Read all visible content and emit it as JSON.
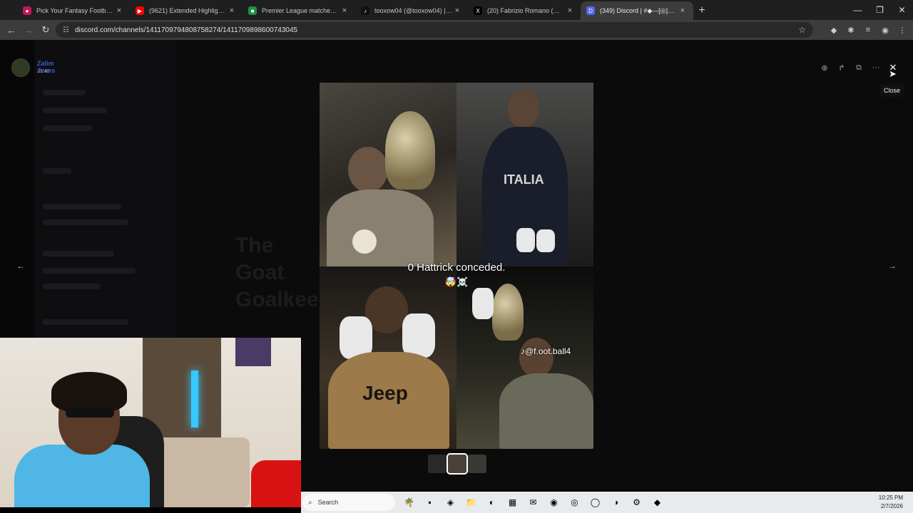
{
  "browser": {
    "tabs": [
      {
        "title": "Pick Your Fantasy Football Team",
        "fav_color": "#c2185b",
        "fav_glyph": "●"
      },
      {
        "title": "(9621) Extended Highlights | M",
        "fav_color": "#ff0000",
        "fav_glyph": "▶"
      },
      {
        "title": "Premier League matches, table",
        "fav_color": "#1e8e3e",
        "fav_glyph": "■"
      },
      {
        "title": "tooxow04 (@tooxow04) | TikTok",
        "fav_color": "#111111",
        "fav_glyph": "♪"
      },
      {
        "title": "(20) Fabrizio Romano (@Fabrizio",
        "fav_color": "#000000",
        "fav_glyph": "X"
      },
      {
        "title": "(349) Discord | #◆—[◎]FOOTB",
        "fav_color": "#5865f2",
        "fav_glyph": "D",
        "active": true
      }
    ],
    "tab_close": "×",
    "new_tab": "+",
    "window_controls": {
      "minimize": "—",
      "maximize": "❐",
      "close": "✕"
    },
    "nav": {
      "back": "←",
      "forward": "→",
      "reload": "↻"
    },
    "url": "discord.com/channels/1411709794808758274/1411709898600743045",
    "star_icon": "☆",
    "extensions": [
      "◆",
      "✱",
      "≡",
      "◉",
      "⋮"
    ]
  },
  "viewer": {
    "user_name": "Zalim Jeans",
    "timestamp": "21:40",
    "tools": {
      "zoom": "⊕",
      "forward": "↱",
      "open": "⧉",
      "more": "···",
      "close": "✕"
    },
    "close_tooltip": "Close",
    "prev_arrow": "←",
    "next_arrow": "→"
  },
  "media": {
    "caption": "0 Hattrick conceded.",
    "emojis": "🤯☠️",
    "shirt_italia": "ITALIA",
    "shirt_jeep": "Jeep",
    "handle": "@f.oot.ball4",
    "tiktok_icon": "♪"
  },
  "background_text": {
    "goat_title": "The\nGoat\nGoalkee"
  },
  "taskbar": {
    "search_placeholder": "Search",
    "search_icon": "⌕",
    "apps": [
      "🌴",
      "▪",
      "◈",
      "📁",
      "◐",
      "▦",
      "✉",
      "◉",
      "◎",
      "◯",
      "◑",
      "⚙",
      "◆"
    ],
    "time": "10:25 PM",
    "date": "2/7/2026"
  },
  "colors": {
    "discord_blurple": "#5865f2",
    "username": "#3b5bd6",
    "webcam_jersey": "#4fb6e6"
  }
}
